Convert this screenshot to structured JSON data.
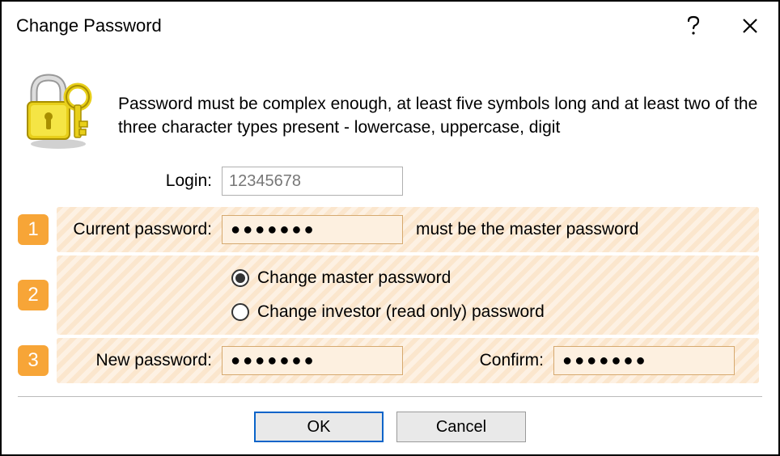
{
  "title": "Change Password",
  "instruction": "Password must be complex enough, at least five symbols long and at least two of the three character types present - lowercase, uppercase, digit",
  "login": {
    "label": "Login:",
    "value": "12345678"
  },
  "steps": {
    "s1": {
      "badge": "1",
      "label": "Current password:",
      "value": "●●●●●●●",
      "hint": "must be the master password"
    },
    "s2": {
      "badge": "2",
      "opt_master": "Change master password",
      "opt_investor": "Change investor (read only) password"
    },
    "s3": {
      "badge": "3",
      "new_label": "New password:",
      "new_value": "●●●●●●●",
      "confirm_label": "Confirm:",
      "confirm_value": "●●●●●●●"
    }
  },
  "buttons": {
    "ok": "OK",
    "cancel": "Cancel"
  }
}
